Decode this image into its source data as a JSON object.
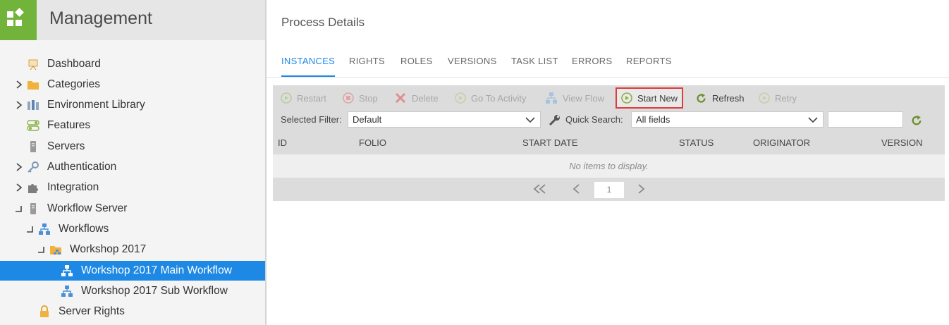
{
  "app": {
    "title": "Management"
  },
  "sidebar": {
    "items": [
      {
        "label": "Dashboard",
        "icon": "dashboard-icon",
        "expander": "none"
      },
      {
        "label": "Categories",
        "icon": "folder-icon",
        "expander": "collapsed"
      },
      {
        "label": "Environment Library",
        "icon": "library-icon",
        "expander": "collapsed"
      },
      {
        "label": "Features",
        "icon": "toggles-icon",
        "expander": "none"
      },
      {
        "label": "Servers",
        "icon": "server-icon",
        "expander": "none"
      },
      {
        "label": "Authentication",
        "icon": "key-icon",
        "expander": "collapsed"
      },
      {
        "label": "Integration",
        "icon": "puzzle-icon",
        "expander": "collapsed"
      },
      {
        "label": "Workflow Server",
        "icon": "server-icon",
        "expander": "expanded"
      },
      {
        "label": "Workflows",
        "icon": "workflow-icon",
        "expander": "expanded"
      },
      {
        "label": "Workshop 2017",
        "icon": "workflow-folder-icon",
        "expander": "expanded"
      },
      {
        "label": "Workshop 2017 Main Workflow",
        "icon": "workflow-icon",
        "expander": "none",
        "selected": true
      },
      {
        "label": "Workshop 2017 Sub Workflow",
        "icon": "workflow-icon",
        "expander": "none"
      },
      {
        "label": "Server Rights",
        "icon": "lock-icon",
        "expander": "none"
      }
    ]
  },
  "main": {
    "title": "Process Details",
    "tabs": [
      {
        "label": "INSTANCES",
        "active": true
      },
      {
        "label": "RIGHTS"
      },
      {
        "label": "ROLES"
      },
      {
        "label": "VERSIONS"
      },
      {
        "label": "TASK LIST"
      },
      {
        "label": "ERRORS"
      },
      {
        "label": "REPORTS"
      }
    ],
    "toolbar": {
      "restart": "Restart",
      "stop": "Stop",
      "delete": "Delete",
      "go_to_activity": "Go To Activity",
      "view_flow": "View Flow",
      "start_new": "Start New",
      "refresh": "Refresh",
      "retry": "Retry"
    },
    "filter": {
      "label": "Selected Filter:",
      "value": "Default",
      "quick_search_label": "Quick Search:",
      "quick_search_scope": "All fields",
      "quick_search_value": ""
    },
    "columns": [
      "ID",
      "FOLIO",
      "START DATE",
      "STATUS",
      "ORIGINATOR",
      "VERSION"
    ],
    "empty_message": "No items to display.",
    "pager": {
      "current_page": "1"
    }
  },
  "colors": {
    "accent": "#1e88e5",
    "brand": "#72b33c",
    "highlight": "#e03c3c"
  }
}
